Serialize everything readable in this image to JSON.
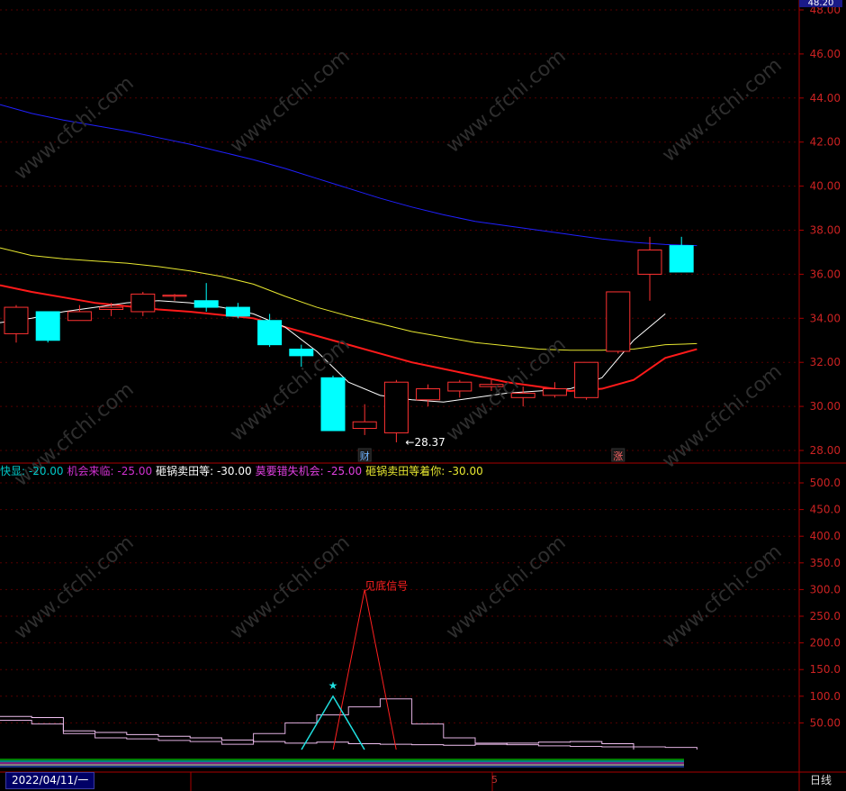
{
  "status": {
    "date": "2022/04/11/一",
    "period": "日线",
    "page_marker": "5",
    "last_price": "48.20"
  },
  "watermark": "www.cfchi.com",
  "colors": {
    "up": "#ff3232",
    "down": "#00ffff",
    "ma_short": "#ffffff",
    "ma_mid": "#ff1a1a",
    "ma_long": "#e8e830",
    "ma_longest": "#2020ff",
    "axis": "#aa0000",
    "axis_text": "#cc2222",
    "grid": "#550000"
  },
  "chart_data": [
    {
      "type": "candlestick",
      "ylim": [
        27.4,
        48.4
      ],
      "y_ticks": [
        "28.00",
        "30.00",
        "32.00",
        "34.00",
        "36.00",
        "38.00",
        "40.00",
        "42.00",
        "44.00",
        "46.00",
        "48.00"
      ],
      "candles": [
        {
          "o": 33.3,
          "h": 34.6,
          "l": 32.9,
          "c": 34.5
        },
        {
          "o": 34.3,
          "h": 34.3,
          "l": 32.9,
          "c": 33.0
        },
        {
          "o": 33.9,
          "h": 34.6,
          "l": 33.9,
          "c": 34.3
        },
        {
          "o": 34.4,
          "h": 34.7,
          "l": 34.1,
          "c": 34.5
        },
        {
          "o": 34.3,
          "h": 35.2,
          "l": 34.1,
          "c": 35.1
        },
        {
          "o": 35.0,
          "h": 35.1,
          "l": 34.8,
          "c": 35.05
        },
        {
          "o": 34.8,
          "h": 35.6,
          "l": 34.3,
          "c": 34.5
        },
        {
          "o": 34.5,
          "h": 34.7,
          "l": 34.0,
          "c": 34.1
        },
        {
          "o": 33.9,
          "h": 34.2,
          "l": 32.7,
          "c": 32.8
        },
        {
          "o": 32.6,
          "h": 32.8,
          "l": 31.8,
          "c": 32.3
        },
        {
          "o": 31.3,
          "h": 31.4,
          "l": 28.9,
          "c": 28.9
        },
        {
          "o": 29.0,
          "h": 30.1,
          "l": 28.7,
          "c": 29.3
        },
        {
          "o": 28.8,
          "h": 31.2,
          "l": 28.37,
          "c": 31.1
        },
        {
          "o": 30.3,
          "h": 31.0,
          "l": 30.0,
          "c": 30.8
        },
        {
          "o": 30.7,
          "h": 31.2,
          "l": 30.4,
          "c": 31.1
        },
        {
          "o": 30.9,
          "h": 31.2,
          "l": 30.7,
          "c": 31.0
        },
        {
          "o": 30.4,
          "h": 30.9,
          "l": 30.0,
          "c": 30.6
        },
        {
          "o": 30.5,
          "h": 31.1,
          "l": 30.4,
          "c": 30.8
        },
        {
          "o": 30.4,
          "h": 32.0,
          "l": 30.3,
          "c": 32.0
        },
        {
          "o": 32.5,
          "h": 35.2,
          "l": 32.4,
          "c": 35.2
        },
        {
          "o": 36.0,
          "h": 37.7,
          "l": 34.8,
          "c": 37.1
        },
        {
          "o": 37.3,
          "h": 37.7,
          "l": 36.1,
          "c": 36.1
        }
      ],
      "ma_short": [
        33.8,
        34.0,
        34.3,
        34.5,
        34.7,
        34.8,
        34.7,
        34.5,
        34.2,
        33.6,
        32.5,
        31.1,
        30.5,
        30.3,
        30.2,
        30.4,
        30.6,
        30.7,
        30.8,
        31.3,
        33.0,
        34.2
      ],
      "ma_mid": [
        35.5,
        35.2,
        34.95,
        34.7,
        34.55,
        34.4,
        34.3,
        34.15,
        34.0,
        33.6,
        33.2,
        32.8,
        32.4,
        32.0,
        31.7,
        31.4,
        31.1,
        30.9,
        30.7,
        30.8,
        31.2,
        32.2,
        32.6
      ],
      "ma_long": [
        37.2,
        36.85,
        36.7,
        36.6,
        36.5,
        36.35,
        36.15,
        35.9,
        35.55,
        35.0,
        34.5,
        34.1,
        33.75,
        33.4,
        33.15,
        32.9,
        32.75,
        32.6,
        32.55,
        32.55,
        32.6,
        32.8,
        32.85
      ],
      "ma_longest": [
        43.7,
        43.3,
        43.0,
        42.75,
        42.5,
        42.2,
        41.9,
        41.55,
        41.2,
        40.8,
        40.35,
        39.9,
        39.45,
        39.05,
        38.7,
        38.4,
        38.2,
        38.0,
        37.8,
        37.6,
        37.45,
        37.35,
        37.3
      ],
      "annotations": [
        {
          "text": "←28.37",
          "candle": 12,
          "price": 28.37,
          "color": "#ffffff"
        },
        {
          "text": "财",
          "candle": 11,
          "color": "#6fb3ff",
          "kind": "badge"
        },
        {
          "text": "涨",
          "candle": 19,
          "color": "#ff6666",
          "kind": "badge"
        }
      ]
    },
    {
      "type": "indicator",
      "ylim": [
        0,
        500
      ],
      "y_ticks": [
        "50.00",
        "100.0",
        "150.0",
        "200.0",
        "250.0",
        "300.0",
        "350.0",
        "400.0",
        "450.0",
        "500.0"
      ],
      "legend": [
        {
          "label": "快显:",
          "value": "-20.00",
          "color": "#00c8c8"
        },
        {
          "label": "机会来临:",
          "value": "-25.00",
          "color": "#d030d0"
        },
        {
          "label": "砸锅卖田等:",
          "value": "-30.00",
          "color": "#ffffff"
        },
        {
          "label": "莫要错失机会:",
          "value": "-25.00",
          "color": "#e040e0"
        },
        {
          "label": "砸锅卖田等着你:",
          "value": "-30.00",
          "color": "#e8e830"
        }
      ],
      "steps_tall": [
        62,
        60,
        35,
        32,
        28,
        25,
        22,
        18,
        15,
        12,
        14,
        11,
        10,
        9,
        8,
        10,
        12,
        14,
        15,
        11
      ],
      "steps_mid": [
        55,
        48,
        30,
        22,
        20,
        17,
        15,
        10,
        30,
        50,
        65,
        80,
        95,
        48,
        22,
        12,
        9,
        7,
        6,
        5,
        5,
        4
      ],
      "peak_signal": {
        "label": "见底信号",
        "peak": 300,
        "candle": 11,
        "color": "#ff2020"
      },
      "star_signal": {
        "peak": 100,
        "candle": 10,
        "color": "#20e0e0"
      }
    }
  ]
}
